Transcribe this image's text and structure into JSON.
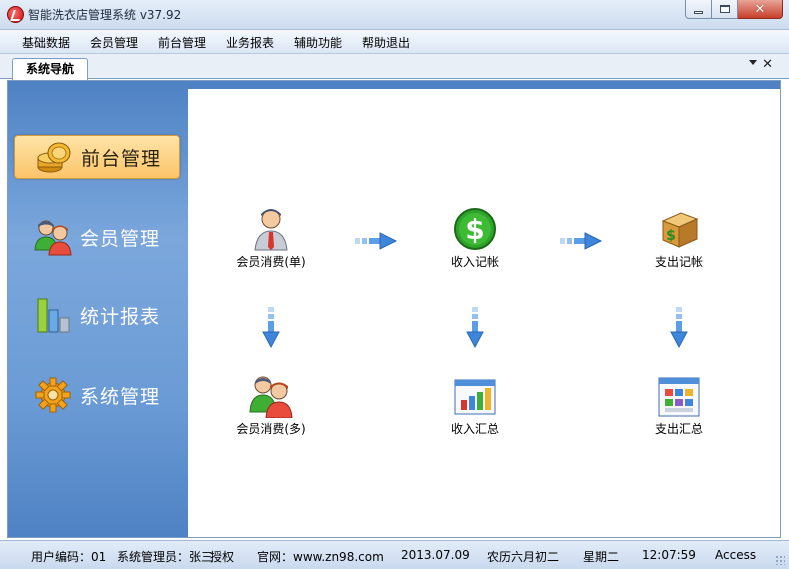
{
  "window": {
    "title": "智能洗衣店管理系统 v37.92"
  },
  "menu": [
    "基础数据",
    "会员管理",
    "前台管理",
    "业务报表",
    "辅助功能",
    "帮助退出"
  ],
  "tab": {
    "label": "系统导航"
  },
  "sidebar": {
    "items": [
      {
        "label": "前台管理",
        "icon": "coins-icon",
        "active": true
      },
      {
        "label": "会员管理",
        "icon": "users-icon",
        "active": false
      },
      {
        "label": "统计报表",
        "icon": "bar-chart-icon",
        "active": false
      },
      {
        "label": "系统管理",
        "icon": "gear-icon",
        "active": false
      }
    ]
  },
  "functions": [
    {
      "label": "会员消费(单)",
      "icon": "user-icon"
    },
    {
      "label": "收入记帐",
      "icon": "dollar-icon"
    },
    {
      "label": "支出记帐",
      "icon": "money-box-icon"
    },
    {
      "label": "会员消费(多)",
      "icon": "users-icon"
    },
    {
      "label": "收入汇总",
      "icon": "chart-window-icon"
    },
    {
      "label": "支出汇总",
      "icon": "grid-window-icon"
    }
  ],
  "status": {
    "user_code": "用户编码：01",
    "user_role": "系统管理员：张三",
    "license": "授权",
    "website": "官网：www.zn98.com",
    "date": "2013.07.09",
    "lunar": "农历六月初二",
    "weekday": "星期二",
    "time": "12:07:59",
    "db": "Access"
  }
}
